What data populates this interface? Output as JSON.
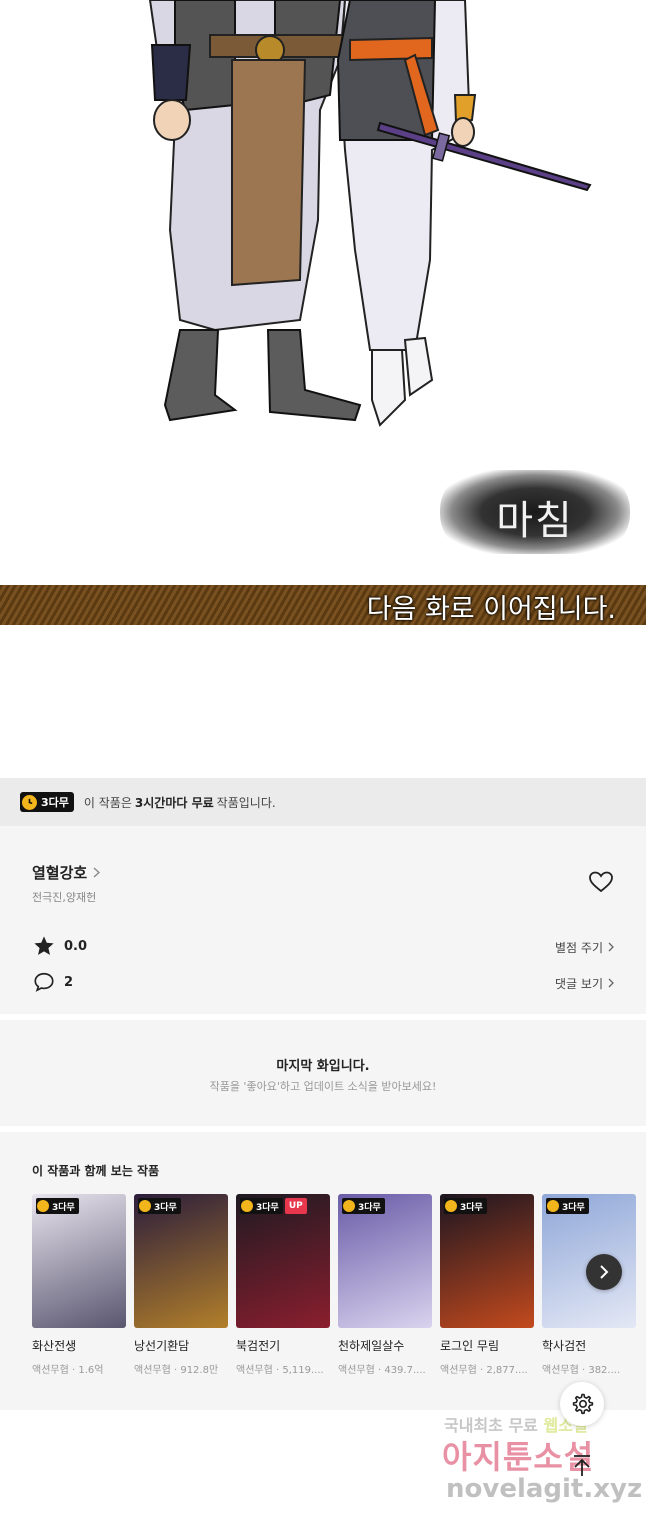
{
  "comic": {
    "end_mark": "마침",
    "next_notice": "다음 화로 이어집니다."
  },
  "free_notice": {
    "badge": "3다무",
    "text_before": "이 작품은",
    "text_bold": "3시간마다 무료",
    "text_after": "작품입니다."
  },
  "work": {
    "title": "열혈강호",
    "authors": "전극진,양재헌",
    "rating": "0.0",
    "rating_action": "별점 주기",
    "comment_count": "2",
    "comment_action": "댓글 보기"
  },
  "last_episode": {
    "title": "마지막 화입니다.",
    "subtitle": "작품을 '좋아요'하고 업데이트 소식을 받아보세요!"
  },
  "recommendations": {
    "heading": "이 작품과 함께 보는 작품",
    "items": [
      {
        "title": "화산전생",
        "meta": "액션무협 · 1.6억",
        "badge": "3다무",
        "up": "",
        "colors": [
          "#e8e4ee",
          "#5a5670"
        ]
      },
      {
        "title": "낭선기환담",
        "meta": "액션무협 · 912.8만",
        "badge": "3다무",
        "up": "",
        "colors": [
          "#2b1d3c",
          "#b27f2a"
        ]
      },
      {
        "title": "북검전기",
        "meta": "액션무협 · 5,119....",
        "badge": "3다무",
        "up": "UP",
        "colors": [
          "#1e1a22",
          "#8b1e2e"
        ]
      },
      {
        "title": "천하제일살수",
        "meta": "액션무협 · 439.7....",
        "badge": "3다무",
        "up": "",
        "colors": [
          "#6a5ca8",
          "#d9d3ee"
        ]
      },
      {
        "title": "로그인 무림",
        "meta": "액션무협 · 2,877....",
        "badge": "3다무",
        "up": "",
        "colors": [
          "#1c1520",
          "#c34a1e"
        ]
      },
      {
        "title": "학사검전",
        "meta": "액션무협 · 382....",
        "badge": "3다무",
        "up": "",
        "colors": [
          "#8fa7d8",
          "#e4e8f5"
        ]
      }
    ]
  },
  "watermark": {
    "line1_a": "국내최초 무료",
    "line1_b": "웹소설",
    "line2": "아지툰소설",
    "line3": "novelagit.xyz"
  },
  "icons": {
    "clock": "clock-icon",
    "star": "star-icon",
    "comment": "comment-icon",
    "heart": "heart-icon",
    "settings": "gear-icon",
    "scroll_top": "arrow-up-icon",
    "next": "chevron-right-icon"
  }
}
